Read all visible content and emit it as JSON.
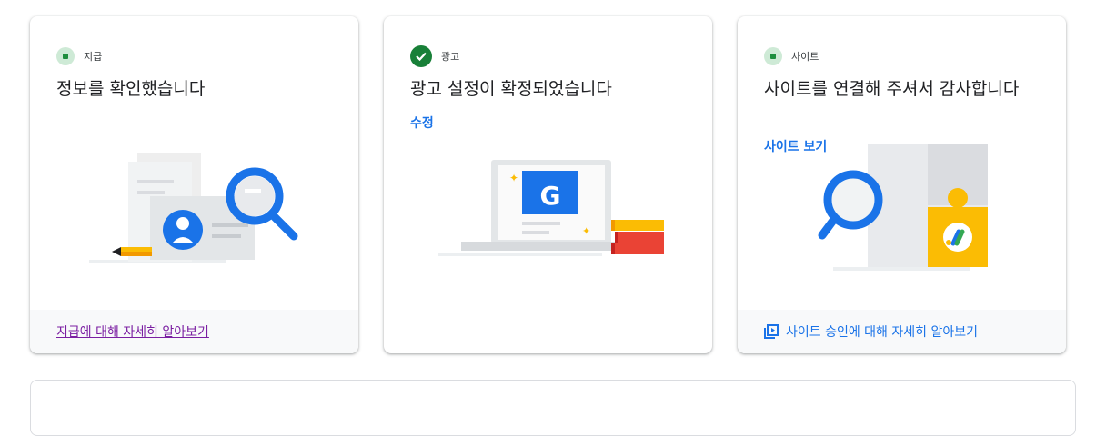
{
  "cards": [
    {
      "tag": "지급",
      "status": "pending",
      "title": "정보를 확인했습니다",
      "footer_link": "지급에 대해 자세히 알아보기"
    },
    {
      "tag": "광고",
      "status": "complete",
      "title": "광고 설정이 확정되었습니다",
      "action": "수정",
      "illustration_letter": "G"
    },
    {
      "tag": "사이트",
      "status": "pending",
      "title": "사이트를 연결해 주셔서 감사합니다",
      "action": "사이트 보기",
      "footer_link": "사이트 승인에 대해 자세히 알아보기"
    }
  ],
  "colors": {
    "accent_blue": "#1a73e8",
    "visited_link": "#7b1fa2",
    "success_green": "#188038",
    "pending_green_bg": "#ceead6",
    "google_yellow": "#fbbc04",
    "google_red": "#ea4335"
  }
}
